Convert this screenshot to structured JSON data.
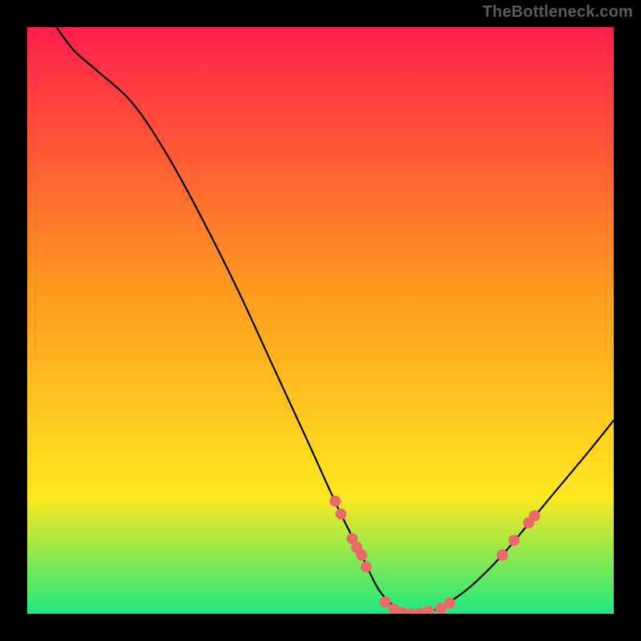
{
  "watermark": "TheBottleneck.com",
  "chart_data": {
    "type": "line",
    "title": "",
    "xlabel": "",
    "ylabel": "",
    "xlim": [
      0,
      100
    ],
    "ylim": [
      0,
      100
    ],
    "grid": false,
    "legend": false,
    "background_gradient": {
      "top": "#ff1f4b",
      "mid1": "#ff9a1f",
      "mid2": "#ffe81f",
      "bottom": "#1fe87f"
    },
    "curve": {
      "description": "Monotone descent from top-left to a minimum near x≈66 at y≈0, then rise toward right",
      "points": [
        {
          "x": 5.0,
          "y": 100.0
        },
        {
          "x": 8.0,
          "y": 96.0
        },
        {
          "x": 12.0,
          "y": 92.5
        },
        {
          "x": 18.0,
          "y": 87.0
        },
        {
          "x": 24.0,
          "y": 78.0
        },
        {
          "x": 30.0,
          "y": 67.0
        },
        {
          "x": 36.0,
          "y": 55.0
        },
        {
          "x": 42.0,
          "y": 42.0
        },
        {
          "x": 48.0,
          "y": 29.0
        },
        {
          "x": 53.0,
          "y": 18.0
        },
        {
          "x": 57.0,
          "y": 10.0
        },
        {
          "x": 60.0,
          "y": 4.0
        },
        {
          "x": 63.0,
          "y": 1.0
        },
        {
          "x": 66.0,
          "y": 0.0
        },
        {
          "x": 69.0,
          "y": 0.5
        },
        {
          "x": 72.0,
          "y": 2.0
        },
        {
          "x": 76.0,
          "y": 5.0
        },
        {
          "x": 81.0,
          "y": 10.0
        },
        {
          "x": 86.0,
          "y": 16.0
        },
        {
          "x": 91.0,
          "y": 22.0
        },
        {
          "x": 96.0,
          "y": 28.0
        },
        {
          "x": 100.0,
          "y": 33.0
        }
      ]
    },
    "marker_color": "#ea6a6a",
    "markers": [
      {
        "x": 52.5,
        "y": 19.2
      },
      {
        "x": 53.5,
        "y": 17.0
      },
      {
        "x": 55.4,
        "y": 12.8
      },
      {
        "x": 56.2,
        "y": 11.3
      },
      {
        "x": 57.0,
        "y": 10.0
      },
      {
        "x": 57.8,
        "y": 8.0
      },
      {
        "x": 61.0,
        "y": 2.0
      },
      {
        "x": 62.5,
        "y": 0.8
      },
      {
        "x": 64.0,
        "y": 0.2
      },
      {
        "x": 65.5,
        "y": 0.0
      },
      {
        "x": 67.0,
        "y": 0.1
      },
      {
        "x": 68.5,
        "y": 0.4
      },
      {
        "x": 70.5,
        "y": 0.9
      },
      {
        "x": 72.0,
        "y": 1.8
      },
      {
        "x": 81.0,
        "y": 10.0
      },
      {
        "x": 83.0,
        "y": 12.5
      },
      {
        "x": 85.5,
        "y": 15.5
      },
      {
        "x": 86.5,
        "y": 16.7
      }
    ]
  }
}
